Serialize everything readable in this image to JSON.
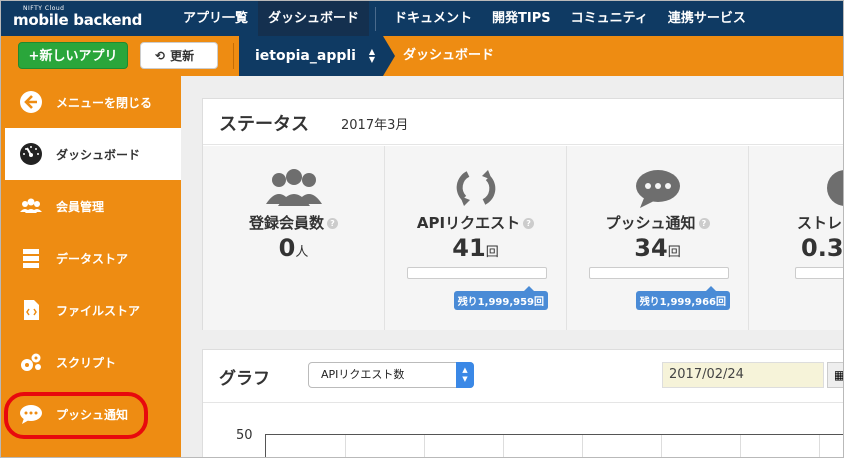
{
  "topbar": {
    "logo_small": "NIFTY Cloud",
    "logo_big": "mobile backend",
    "nav": [
      "アプリ一覧",
      "ダッシュボード",
      "ドキュメント",
      "開発TIPS",
      "コミュニティ",
      "連携サービス"
    ]
  },
  "toolbar": {
    "new_app_label": "+新しいアプリ",
    "refresh_icon": "⟲",
    "refresh_label": "更新",
    "app_name": "ietopia_appli",
    "breadcrumb": "ダッシュボード"
  },
  "sidebar": {
    "items": [
      {
        "label": "メニューを閉じる",
        "icon": "back-arrow-icon"
      },
      {
        "label": "ダッシュボード",
        "icon": "dashboard-gauge-icon"
      },
      {
        "label": "会員管理",
        "icon": "users-icon"
      },
      {
        "label": "データストア",
        "icon": "database-icon"
      },
      {
        "label": "ファイルストア",
        "icon": "file-icon"
      },
      {
        "label": "スクリプト",
        "icon": "gears-icon"
      },
      {
        "label": "プッシュ通知",
        "icon": "chat-bubble-icon"
      }
    ]
  },
  "status": {
    "title": "ステータス",
    "date": "2017年3月",
    "stats": [
      {
        "name": "登録会員数",
        "value": "0",
        "unit": "人",
        "remaining": ""
      },
      {
        "name": "APIリクエスト",
        "value": "41",
        "unit": "回",
        "remaining": "残り1,999,959回"
      },
      {
        "name": "プッシュ通知",
        "value": "34",
        "unit": "回",
        "remaining": "残り1,999,966回"
      },
      {
        "name": "ストレ",
        "value": "0.3",
        "unit": "",
        "remaining": ""
      }
    ]
  },
  "graph": {
    "title": "グラフ",
    "select_value": "APIリクエスト数",
    "date_value": "2017/02/24",
    "y_tick": "50"
  }
}
